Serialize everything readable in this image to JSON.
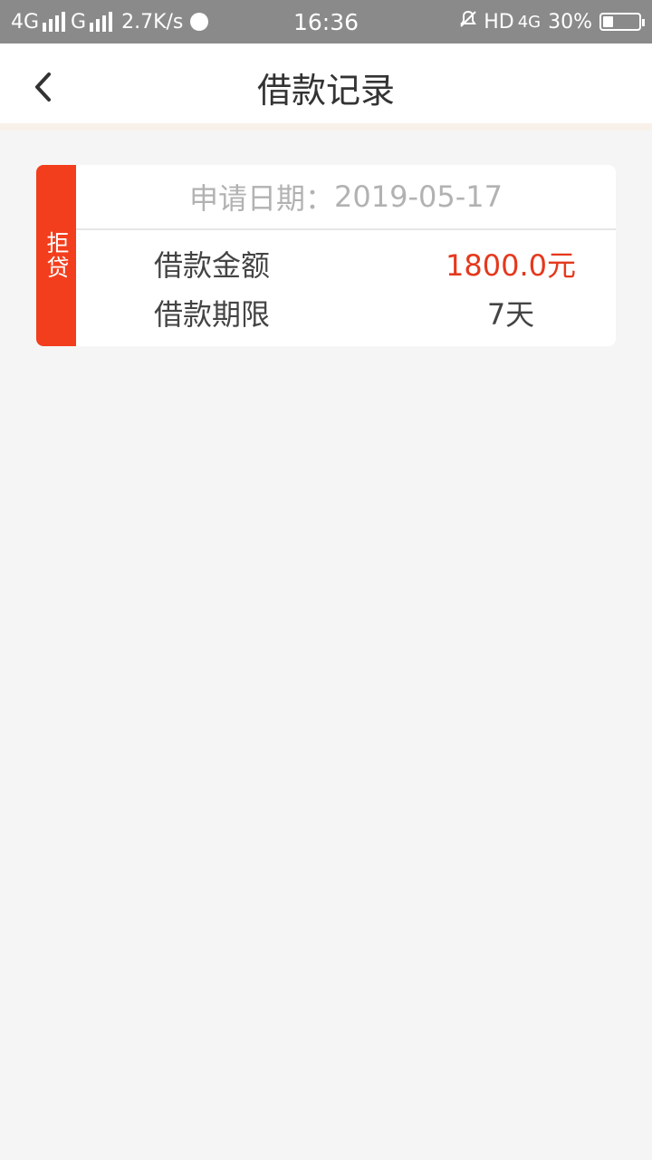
{
  "status_bar": {
    "network_1": "4G",
    "network_2": "G",
    "speed": "2.7K/s",
    "time": "16:36",
    "hd": "HD",
    "network_3": "4G",
    "battery": "30%",
    "battery_level": 0.3
  },
  "header": {
    "title": "借款记录",
    "back_icon": "chevron-left-icon"
  },
  "record": {
    "status": "拒贷",
    "status_color": "#f33e1d",
    "date_label": "申请日期：",
    "date_value": "2019-05-17",
    "amount_label": "借款金额",
    "amount_value": "1800.0元",
    "term_label": "借款期限",
    "term_value": "7天",
    "amount_color": "#e5381c"
  }
}
